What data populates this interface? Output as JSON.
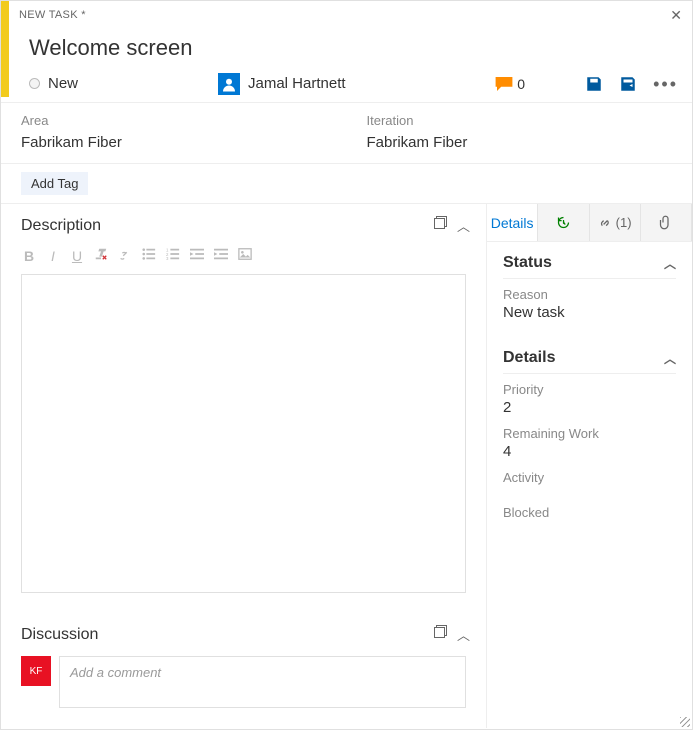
{
  "header": {
    "type_label": "NEW TASK *",
    "title": "Welcome screen",
    "state": "New",
    "assignee": "Jamal Hartnett",
    "comment_count": "0"
  },
  "classification": {
    "area_label": "Area",
    "area_value": "Fabrikam Fiber",
    "iteration_label": "Iteration",
    "iteration_value": "Fabrikam Fiber"
  },
  "tags": {
    "add_tag": "Add Tag"
  },
  "sections": {
    "description": "Description",
    "discussion": "Discussion"
  },
  "discussion": {
    "placeholder": "Add a comment",
    "avatar_initials": "KF"
  },
  "tabs": {
    "details": "Details",
    "links_count": "(1)"
  },
  "status": {
    "heading": "Status",
    "reason_label": "Reason",
    "reason_value": "New task"
  },
  "details": {
    "heading": "Details",
    "priority_label": "Priority",
    "priority_value": "2",
    "remaining_label": "Remaining Work",
    "remaining_value": "4",
    "activity_label": "Activity",
    "blocked_label": "Blocked"
  }
}
